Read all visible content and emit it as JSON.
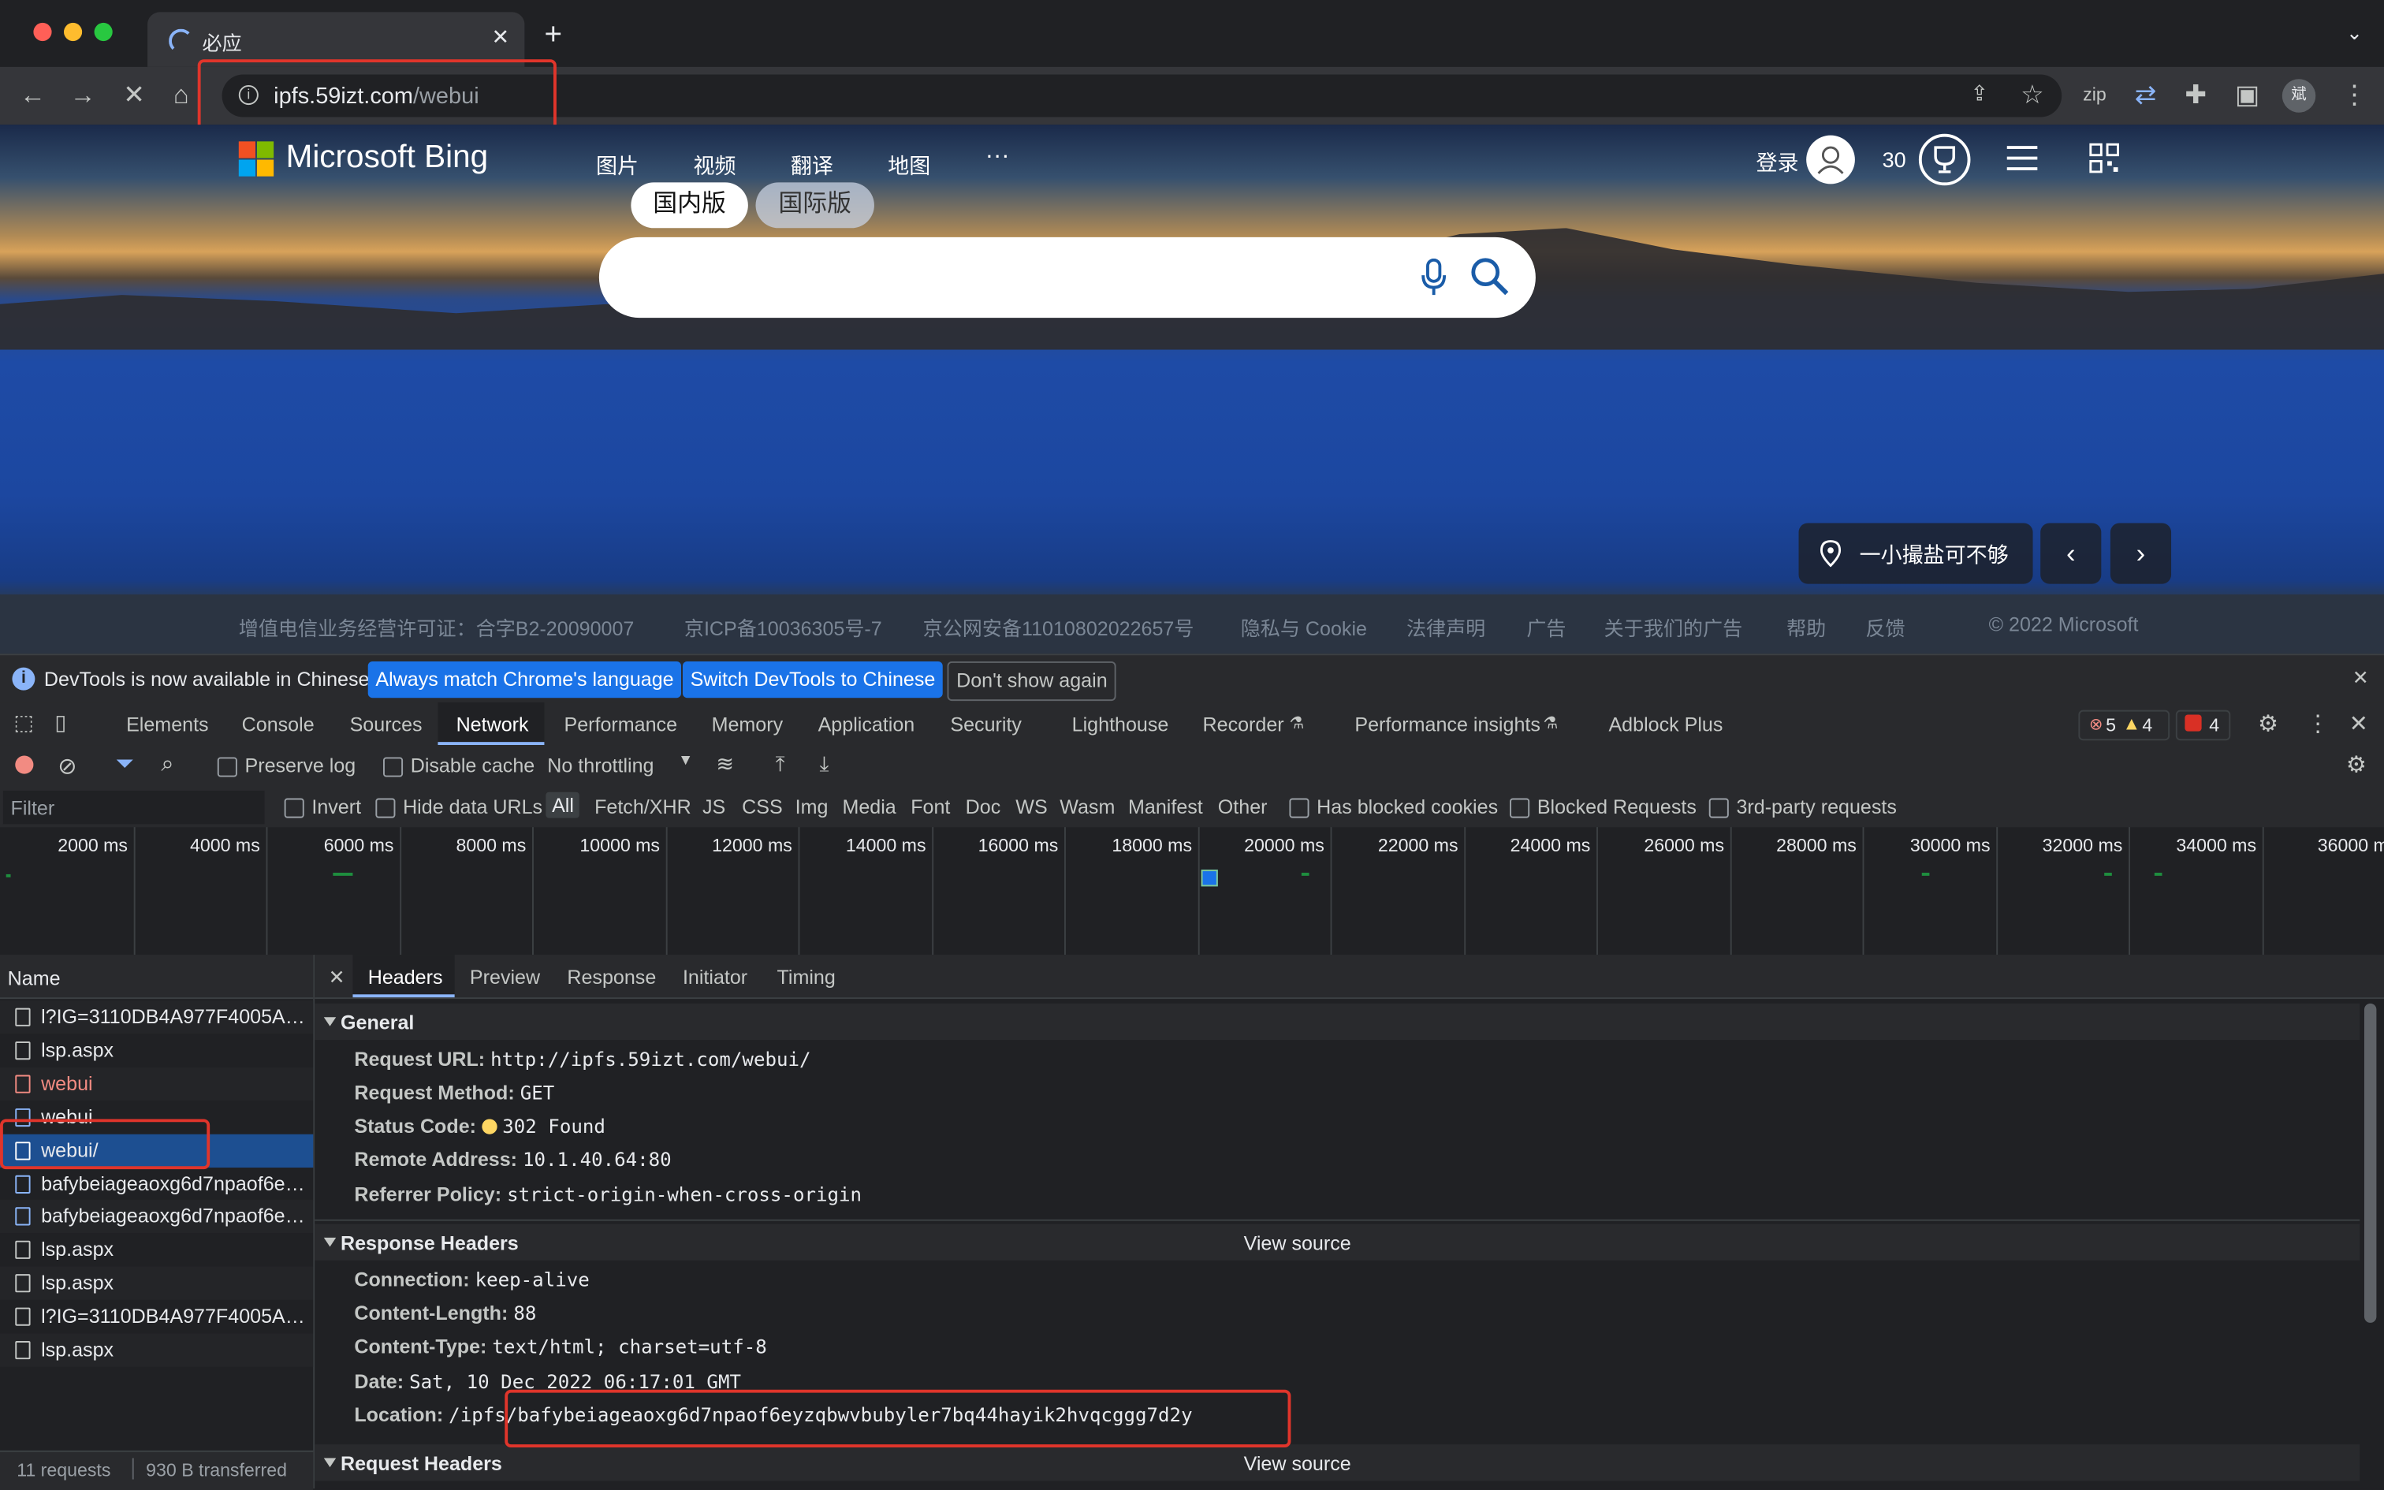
{
  "browser": {
    "tab_title": "必应",
    "url_host": "ipfs.59izt.com",
    "url_path": "/webui",
    "profile_initial": "斌"
  },
  "bing": {
    "logo_text": "Microsoft Bing",
    "nav": [
      "图片",
      "视频",
      "翻译",
      "地图",
      "···"
    ],
    "version_domestic": "国内版",
    "version_intl": "国际版",
    "signin": "登录",
    "points": "30",
    "location_caption": "一小撮盐可不够",
    "footer": [
      "增值电信业务经营许可证：合字B2-20090007",
      "京ICP备10036305号-7",
      "京公网安备11010802022657号",
      "隐私与 Cookie",
      "法律声明",
      "广告",
      "关于我们的广告",
      "帮助",
      "反馈",
      "© 2022 Microsoft"
    ]
  },
  "devtools": {
    "infobar": {
      "message": "DevTools is now available in Chinese!",
      "btn_match": "Always match Chrome's language",
      "btn_switch": "Switch DevTools to Chinese",
      "btn_dismiss": "Don't show again"
    },
    "tabs": [
      "Elements",
      "Console",
      "Sources",
      "Network",
      "Performance",
      "Memory",
      "Application",
      "Security",
      "Lighthouse",
      "Recorder",
      "Performance insights",
      "Adblock Plus"
    ],
    "counts": {
      "errors": "5",
      "warnings": "4",
      "issues": "4"
    },
    "network_toolbar": {
      "preserve_log": "Preserve log",
      "disable_cache": "Disable cache",
      "throttling": "No throttling"
    },
    "filter": {
      "placeholder": "Filter",
      "invert": "Invert",
      "hide_data_urls": "Hide data URLs",
      "types": [
        "All",
        "Fetch/XHR",
        "JS",
        "CSS",
        "Img",
        "Media",
        "Font",
        "Doc",
        "WS",
        "Wasm",
        "Manifest",
        "Other"
      ],
      "has_blocked_cookies": "Has blocked cookies",
      "blocked_requests": "Blocked Requests",
      "third_party": "3rd-party requests"
    },
    "timeline_ticks": [
      "2000 ms",
      "4000 ms",
      "6000 ms",
      "8000 ms",
      "10000 ms",
      "12000 ms",
      "14000 ms",
      "16000 ms",
      "18000 ms",
      "20000 ms",
      "22000 ms",
      "24000 ms",
      "26000 ms",
      "28000 ms",
      "30000 ms",
      "32000 ms",
      "34000 ms",
      "36000 m"
    ],
    "request_list": {
      "header": "Name",
      "items": [
        "l?IG=3110DB4A977F4005A9...",
        "lsp.aspx",
        "webui",
        "webui",
        "webui/",
        "bafybeiageaoxg6d7npaof6ey...",
        "bafybeiageaoxg6d7npaof6ey...",
        "lsp.aspx",
        "lsp.aspx",
        "l?IG=3110DB4A977F4005A9...",
        "lsp.aspx"
      ],
      "summary_requests": "11 requests",
      "summary_transferred": "930 B transferred"
    },
    "detail_tabs": [
      "Headers",
      "Preview",
      "Response",
      "Initiator",
      "Timing"
    ],
    "general": {
      "title": "General",
      "request_url_k": "Request URL:",
      "request_url_v": "http://ipfs.59izt.com/webui/",
      "method_k": "Request Method:",
      "method_v": "GET",
      "status_k": "Status Code:",
      "status_v": "302 Found",
      "remote_k": "Remote Address:",
      "remote_v": "10.1.40.64:80",
      "referrer_k": "Referrer Policy:",
      "referrer_v": "strict-origin-when-cross-origin"
    },
    "response_headers": {
      "title": "Response Headers",
      "view_source": "View source",
      "connection_k": "Connection:",
      "connection_v": "keep-alive",
      "length_k": "Content-Length:",
      "length_v": "88",
      "type_k": "Content-Type:",
      "type_v": "text/html; charset=utf-8",
      "date_k": "Date:",
      "date_v": "Sat, 10 Dec 2022 06:17:01 GMT",
      "location_k": "Location:",
      "location_v": "/ipfs/bafybeiageaoxg6d7npaof6eyzqbwvbubyler7bq44hayik2hvqcggg7d2y"
    },
    "request_headers": {
      "title": "Request Headers",
      "view_source": "View source"
    }
  },
  "colors": {
    "accent": "#8ab4f8",
    "annotation_red": "#e0352b",
    "selected_row": "#1d4f91",
    "error_red": "#f28b82"
  }
}
